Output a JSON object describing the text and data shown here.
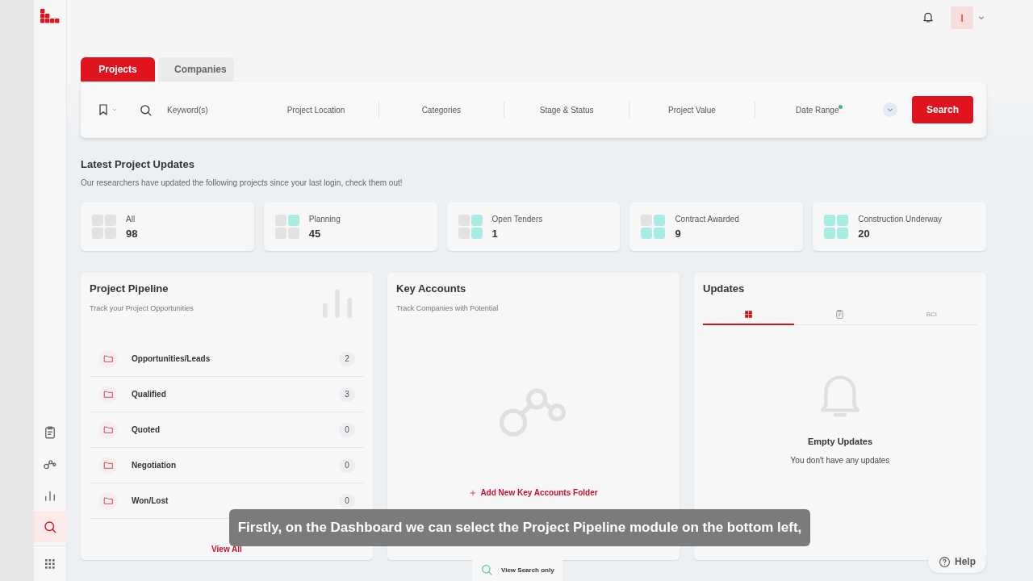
{
  "sidebar": {
    "items": [
      {
        "kind": "clipboard",
        "selected": false
      },
      {
        "kind": "nodes",
        "selected": false
      },
      {
        "kind": "chart",
        "selected": false
      },
      {
        "kind": "search",
        "selected": true
      },
      {
        "kind": "apps",
        "selected": false
      }
    ]
  },
  "header": {
    "avatar": "I"
  },
  "tabs": [
    {
      "label": "Projects",
      "selected": true
    },
    {
      "label": "Companies",
      "selected": false
    }
  ],
  "search_bar": {
    "filters": [
      {
        "label": "Keyword(s)",
        "kind": "keyword",
        "indicator": false
      },
      {
        "label": "Project Location",
        "kind": "plain",
        "indicator": false
      },
      {
        "label": "Categories",
        "kind": "plain",
        "indicator": false
      },
      {
        "label": "Stage & Status",
        "kind": "plain",
        "indicator": false
      },
      {
        "label": "Project Value",
        "kind": "plain",
        "indicator": false
      },
      {
        "label": "Date Range",
        "kind": "plain",
        "indicator": true
      }
    ],
    "button": "Search"
  },
  "latest_updates": {
    "title": "Latest Project Updates",
    "subtitle": "Our researchers have updated the following projects since your last login, check them out!",
    "stats": [
      {
        "label": "All",
        "count": "98",
        "quadrants": [
          {
            "filled": false
          },
          {
            "filled": false
          },
          {
            "filled": false
          },
          {
            "filled": false
          }
        ]
      },
      {
        "label": "Planning",
        "count": "45",
        "quadrants": [
          {
            "filled": false
          },
          {
            "filled": true
          },
          {
            "filled": false
          },
          {
            "filled": false
          }
        ]
      },
      {
        "label": "Open Tenders",
        "count": "1",
        "quadrants": [
          {
            "filled": false
          },
          {
            "filled": true
          },
          {
            "filled": false
          },
          {
            "filled": true
          }
        ]
      },
      {
        "label": "Contract Awarded",
        "count": "9",
        "quadrants": [
          {
            "filled": false
          },
          {
            "filled": true
          },
          {
            "filled": true
          },
          {
            "filled": true
          }
        ]
      },
      {
        "label": "Construction Underway",
        "count": "20",
        "quadrants": [
          {
            "filled": true
          },
          {
            "filled": true
          },
          {
            "filled": true
          },
          {
            "filled": true
          }
        ]
      }
    ]
  },
  "pipeline": {
    "title": "Project Pipeline",
    "subtitle": "Track your Project Opportunities",
    "rows": [
      {
        "label": "Opportunities/Leads",
        "count": "2"
      },
      {
        "label": "Qualified",
        "count": "3"
      },
      {
        "label": "Quoted",
        "count": "0"
      },
      {
        "label": "Negotiation",
        "count": "0"
      },
      {
        "label": "Won/Lost",
        "count": "0"
      }
    ],
    "link": "View All"
  },
  "key_accounts": {
    "title": "Key Accounts",
    "subtitle": "Track Companies with Potential",
    "action": "Add New Key Accounts Folder"
  },
  "updates": {
    "title": "Updates",
    "tabs": [
      {
        "kind": "grid",
        "selected": true
      },
      {
        "kind": "clipboard",
        "selected": false
      },
      {
        "kind": "text",
        "label": "BCI",
        "selected": false
      }
    ],
    "empty_title": "Empty Updates",
    "empty_text": "You don't have any updates"
  },
  "caption": "Firstly, on the Dashboard we can select the Project Pipeline module on the bottom left,",
  "view_search": "View Search only",
  "help": "Help"
}
